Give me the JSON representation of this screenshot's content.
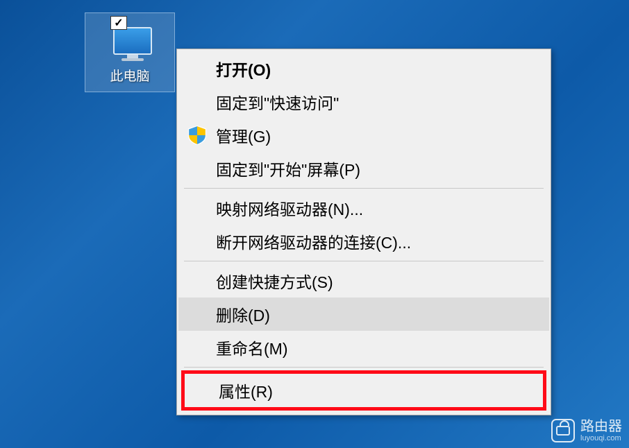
{
  "desktop": {
    "icon_label": "此电脑"
  },
  "context_menu": {
    "items": [
      {
        "label": "打开(O)",
        "bold": true
      },
      {
        "label": "固定到\"快速访问\""
      },
      {
        "label": "管理(G)",
        "shield": true
      },
      {
        "label": "固定到\"开始\"屏幕(P)"
      },
      {
        "separator": true
      },
      {
        "label": "映射网络驱动器(N)..."
      },
      {
        "label": "断开网络驱动器的连接(C)..."
      },
      {
        "separator": true
      },
      {
        "label": "创建快捷方式(S)"
      },
      {
        "label": "删除(D)",
        "hovered": true
      },
      {
        "label": "重命名(M)"
      },
      {
        "separator": true
      },
      {
        "label": "属性(R)",
        "highlighted": true
      }
    ]
  },
  "watermark": {
    "title": "路由器",
    "url": "luyouqi.com"
  }
}
